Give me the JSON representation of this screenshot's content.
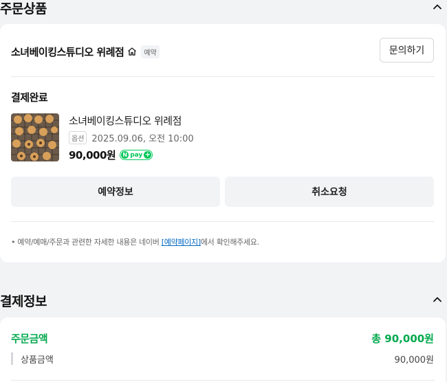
{
  "order_section": {
    "title": "주문상품",
    "store_name": "소녀베이킹스튜디오 위례점",
    "store_tag": "예약",
    "inquiry_label": "문의하기",
    "status": "결제완료",
    "product": {
      "name": "소녀베이킹스튜디오 위례점",
      "option_badge": "옵션",
      "option_text": "2025.09.06, 오전 10:00",
      "price": "90,000원",
      "npay_label": "pay"
    },
    "buttons": {
      "reservation_info": "예약정보",
      "cancel_request": "취소요청"
    },
    "notice": {
      "prefix": "• 예약/예매/주문과 관련한 자세한 내용은 네이버 ",
      "link": "[예약페이지]",
      "suffix": "에서 확인해주세요."
    }
  },
  "payment_section": {
    "title": "결제정보",
    "order_amount_label": "주문금액",
    "order_amount_total": "총 90,000원",
    "product_amount_label": "상품금액",
    "product_amount_value": "90,000원"
  },
  "colors": {
    "accent_green": "#03a94e",
    "npay_green": "#03c75a",
    "link_blue": "#0068c3",
    "background": "#f2f3f5"
  },
  "icons": {
    "collapse": "chevron-up-icon",
    "store": "home-icon"
  }
}
